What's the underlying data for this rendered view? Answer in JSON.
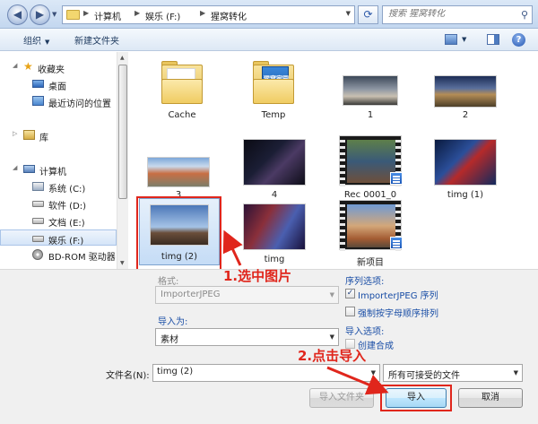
{
  "address": {
    "crumbs": [
      "计算机",
      "娱乐 (F:)",
      "猩窝转化"
    ],
    "search_placeholder": "搜索 猩窝转化"
  },
  "toolbar": {
    "organize": "组织",
    "new_folder": "新建文件夹"
  },
  "nav": {
    "favorites": "收藏夹",
    "desktop": "桌面",
    "recent": "最近访问的位置",
    "library": "库",
    "computer": "计算机",
    "drives": [
      "系统 (C:)",
      "软件 (D:)",
      "文档 (E:)",
      "娱乐 (F:)",
      "BD-ROM 驱动器"
    ]
  },
  "files": [
    {
      "name": "Cache"
    },
    {
      "name": "Temp"
    },
    {
      "name": "1"
    },
    {
      "name": "2"
    },
    {
      "name": "3"
    },
    {
      "name": "4"
    },
    {
      "name": "Rec 0001_0"
    },
    {
      "name": "timg (1)"
    },
    {
      "name": "timg (2)"
    },
    {
      "name": "timg"
    },
    {
      "name": "新项目"
    }
  ],
  "folder_poster_text": "猩窝家园",
  "annotations": {
    "step1": "1.选中图片",
    "step2": "2.点击导入"
  },
  "options": {
    "format_label": "格式:",
    "format_value": "ImporterJPEG",
    "import_as_label": "导入为:",
    "import_as_value": "素材",
    "sequence_options_label": "序列选项:",
    "sequence_checkbox": "ImporterJPEG 序列",
    "force_alpha": "强制按字母顺序排列",
    "import_options_label": "导入选项:",
    "create_comp": "创建合成"
  },
  "filename": {
    "label": "文件名(N):",
    "value": "timg (2)",
    "filter": "所有可接受的文件"
  },
  "buttons": {
    "import_folder": "导入文件夹",
    "import": "导入",
    "cancel": "取消"
  }
}
